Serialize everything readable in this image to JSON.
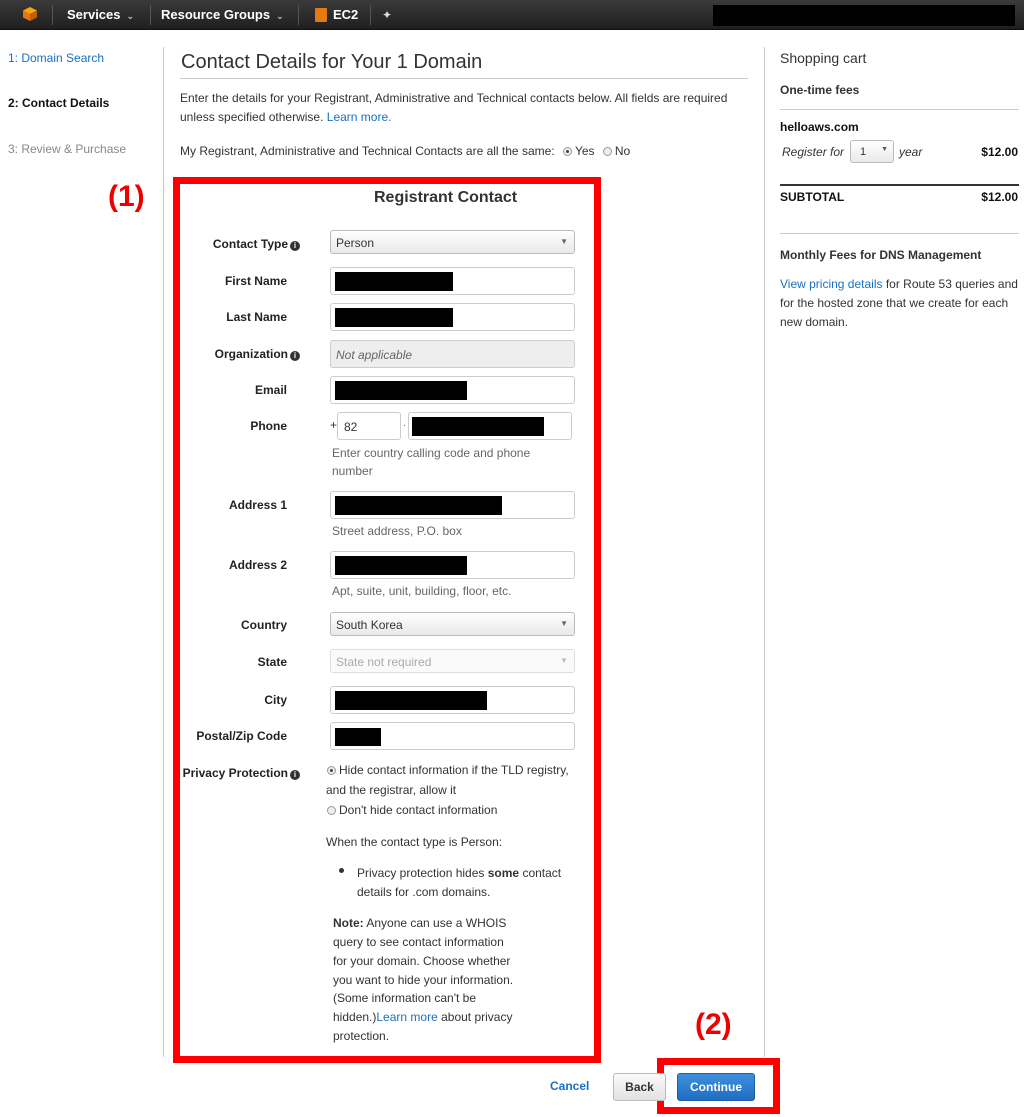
{
  "topbar": {
    "services_label": "Services",
    "resource_groups_label": "Resource Groups",
    "ec2_label": "EC2",
    "caret": "⌄",
    "pin": "✦"
  },
  "steps": [
    {
      "label": "1: Domain Search",
      "state": "link"
    },
    {
      "label": "2: Contact Details",
      "state": "active"
    },
    {
      "label": "3: Review & Purchase",
      "state": "disabled"
    }
  ],
  "main": {
    "title": "Contact Details for Your 1 Domain",
    "description": "Enter the details for your Registrant, Administrative and Technical contacts below. All fields are required unless specified otherwise.",
    "learn_more": "Learn more.",
    "same_question": "My Registrant, Administrative and Technical Contacts are all the same:",
    "yes_label": "Yes",
    "no_label": "No"
  },
  "annotations": {
    "one": "(1)",
    "two": "(2)"
  },
  "form": {
    "section_title": "Registrant Contact",
    "contact_type_label": "Contact Type",
    "contact_type_value": "Person",
    "first_name_label": "First Name",
    "last_name_label": "Last Name",
    "organization_label": "Organization",
    "organization_placeholder": "Not applicable",
    "email_label": "Email",
    "phone_label": "Phone",
    "phone_plus": "+",
    "phone_code": "82",
    "phone_sep": "·",
    "phone_hint_1": "Enter country calling code and phone",
    "phone_hint_2": "number",
    "address1_label": "Address 1",
    "address1_hint": "Street address, P.O. box",
    "address2_label": "Address 2",
    "address2_hint": "Apt, suite, unit, building, floor, etc.",
    "country_label": "Country",
    "country_value": "South Korea",
    "state_label": "State",
    "state_value": "State not required",
    "city_label": "City",
    "postal_label": "Postal/Zip Code",
    "privacy_label": "Privacy Protection",
    "privacy_hide_1": "Hide contact information if the TLD registry,",
    "privacy_hide_2": "and the registrar, allow it",
    "privacy_show": "Don't hide contact information",
    "person_note": "When the contact type is Person:",
    "bullet_pre": "Privacy protection hides",
    "bullet_bold": "some",
    "bullet_post": "contact",
    "bullet_line2": "details for .com domains.",
    "note_label": "Note:",
    "note_l1": "Anyone can use a WHOIS",
    "note_l2": "query to see contact information",
    "note_l3": "for your domain. Choose whether",
    "note_l4": "you want to hide your information.",
    "note_l5": "(Some information can't be",
    "note_l6_pre": "hidden.)",
    "note_link": "Learn more",
    "note_l6_post": "about privacy",
    "note_l7": "protection."
  },
  "buttons": {
    "cancel": "Cancel",
    "back": "Back",
    "continue": "Continue"
  },
  "cart": {
    "title": "Shopping cart",
    "one_time_fees": "One-time fees",
    "domain": "helloaws.com",
    "register_for": "Register for",
    "years_value": "1",
    "year": "year",
    "price": "$12.00",
    "subtotal_label": "SUBTOTAL",
    "subtotal_value": "$12.00",
    "monthly_title": "Monthly Fees for DNS Management",
    "pricing_link": "View pricing details",
    "pricing_text": "for Route 53 queries and for the hosted zone that we create for each new domain."
  },
  "colors": {
    "accent": "#1a6fc4",
    "annotation": "#ff0000",
    "primary_button": "#2b7fd6"
  }
}
